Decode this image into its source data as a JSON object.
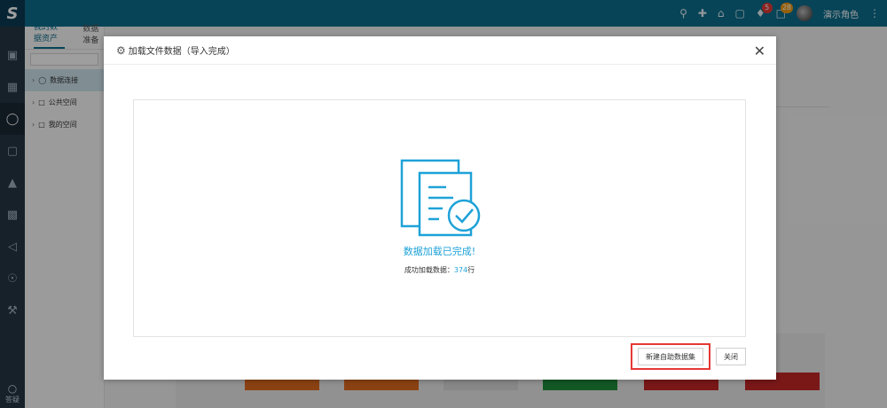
{
  "topbar": {
    "logo": "S",
    "username": "演示角色",
    "notification_count": "5",
    "message_count": "28",
    "colors": {
      "bar": "#0e6f8f",
      "badge_red": "#e53935",
      "badge_orange": "#f39c12"
    }
  },
  "rail": {
    "help_label": "答疑"
  },
  "tree": {
    "tabs": [
      {
        "label": "我的数据资产"
      },
      {
        "label": "数据准备"
      }
    ],
    "items": [
      {
        "label": "数据连接"
      },
      {
        "label": "公共空间"
      },
      {
        "label": "我的空间"
      }
    ]
  },
  "dialog": {
    "title": "加载文件数据（导入完成）",
    "done_title": "数据加载已完成!",
    "detail_prefix": "成功加载数据：",
    "detail_count": "374",
    "detail_suffix": "行",
    "buttons": {
      "new_dataset": "新建自助数据集",
      "close": "关闭"
    },
    "accent_color": "#1ea2d8"
  }
}
